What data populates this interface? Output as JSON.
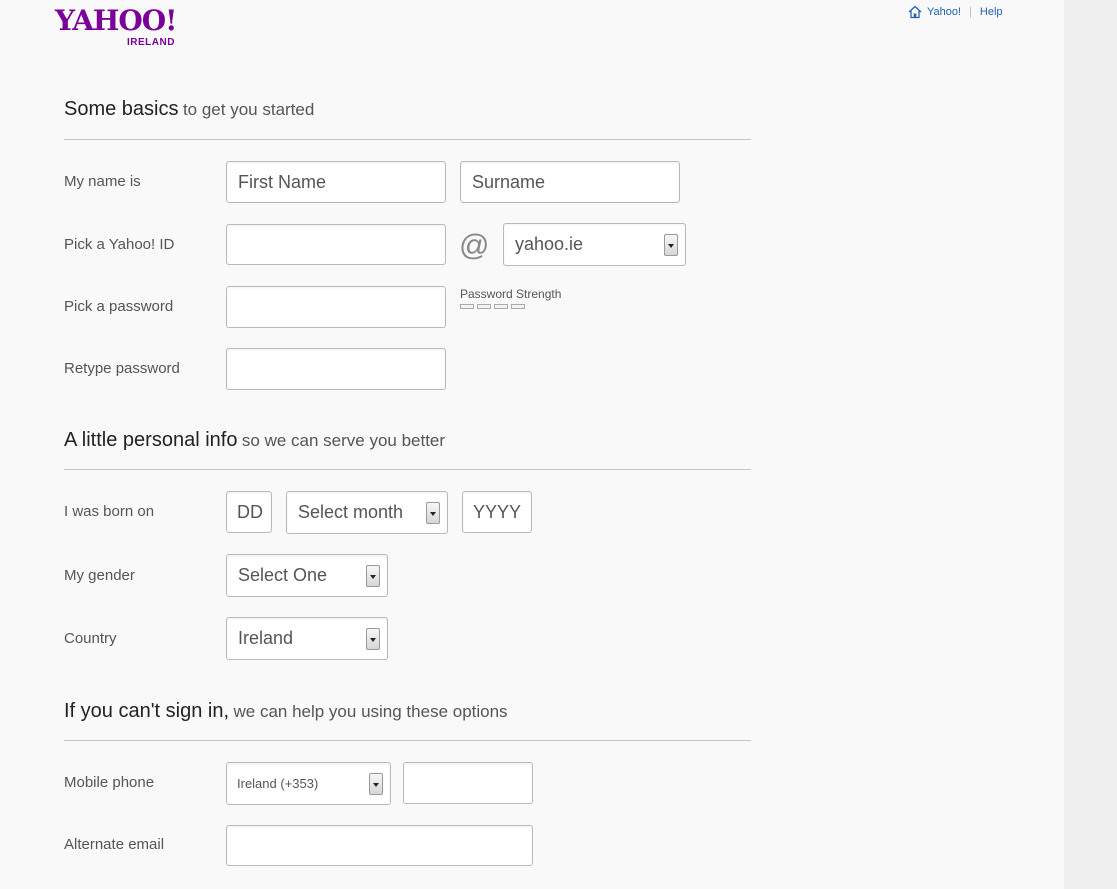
{
  "brand": {
    "logo_text": "YAHOO!",
    "logo_sub": "IRELAND",
    "color": "#7b0099"
  },
  "top_links": {
    "home": "Yahoo!",
    "help": "Help",
    "link_color": "#1e63b4"
  },
  "sections": {
    "basics": {
      "strong": "Some basics",
      "light": "to get you started"
    },
    "personal": {
      "strong": "A little personal info",
      "light": "so we can serve you better"
    },
    "recovery": {
      "strong": "If you can't sign in,",
      "light": "we can help you using these options"
    }
  },
  "labels": {
    "name": "My name is",
    "yahoo_id": "Pick a Yahoo! ID",
    "password": "Pick a password",
    "retype": "Retype password",
    "born": "I was born on",
    "gender": "My gender",
    "country": "Country",
    "mobile": "Mobile phone",
    "alt_email": "Alternate email"
  },
  "fields": {
    "first_name": "First Name",
    "surname": "Surname",
    "yahoo_id": "",
    "at_symbol": "@",
    "domain": "yahoo.ie",
    "password": "",
    "password_strength": "Password Strength",
    "retype": "",
    "dob_day": "DD",
    "dob_month": "Select month",
    "dob_year": "YYYY",
    "gender": "Select One",
    "country": "Ireland",
    "phone_country": "Ireland (+353)",
    "phone": "",
    "alt_email": ""
  }
}
